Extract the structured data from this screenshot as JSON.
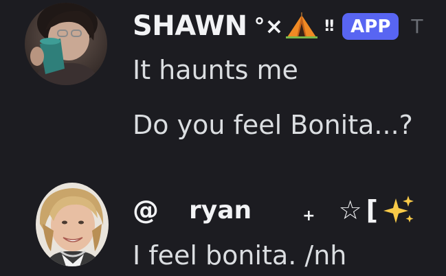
{
  "message_group_1": {
    "username": "SHAWN",
    "name_symbols": "°×",
    "name_emoji_icon": "tent-icon",
    "name_suffix": "‼",
    "app_badge": "APP",
    "timestamp_partial": "T",
    "messages": [
      "It haunts me",
      "Do you feel Bonita...?"
    ]
  },
  "message_group_2": {
    "prefix": "@",
    "username": "ryan",
    "decoration_plus": "+",
    "star": "☆",
    "bracket": "[",
    "name_emoji_icon": "sparkles-icon",
    "messages": [
      "I feel bonita. /nh"
    ]
  },
  "colors": {
    "background": "#1c1c21",
    "username": "#f2f3f5",
    "message_text": "#dbdee1",
    "app_badge": "#5865f2",
    "timestamp": "#6b6e75"
  }
}
